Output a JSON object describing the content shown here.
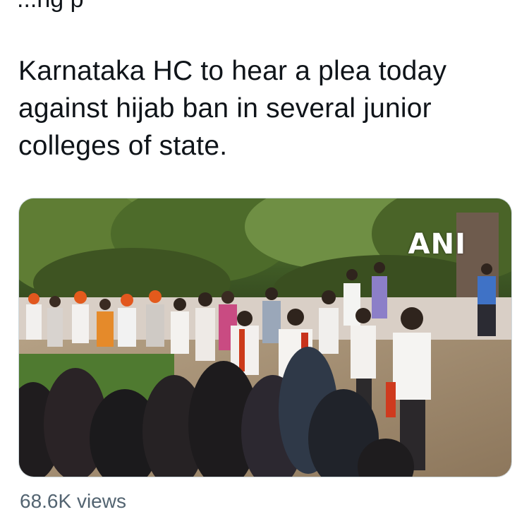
{
  "tweet": {
    "cut_off_line": "...ng    p",
    "text": "Karnataka HC to hear a plea today against hijab ban in several junior colleges of state.",
    "media": {
      "watermark": "ANI",
      "alt": "Crowd of students walking on a campus road, many wearing saffron scarves, with women in hijabs in the foreground"
    },
    "views": "68.6K views"
  },
  "colors": {
    "text": "#0f1419",
    "secondary": "#536471",
    "border": "#cfd9de"
  }
}
